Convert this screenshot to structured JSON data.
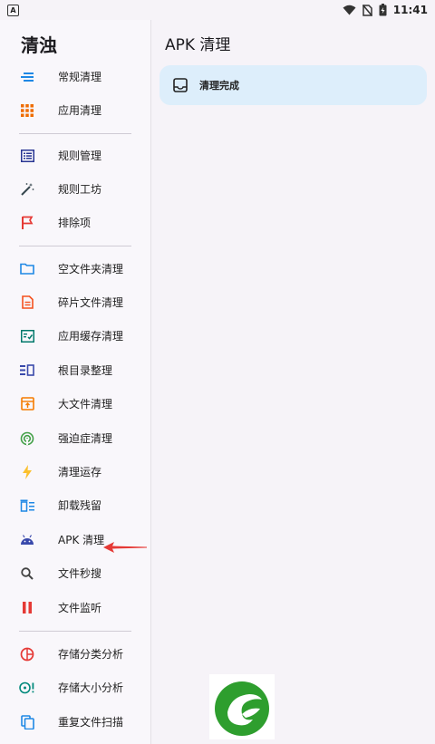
{
  "status_bar": {
    "time": "11:41",
    "notification_icon": "a-icon"
  },
  "drawer": {
    "title": "清浊",
    "groups": [
      [
        {
          "label": "常规清理",
          "icon": "lines-icon",
          "color": "#1e88e5"
        },
        {
          "label": "应用清理",
          "icon": "grid-icon",
          "color": "#ef6c00"
        }
      ],
      [
        {
          "label": "规则管理",
          "icon": "list-icon",
          "color": "#283593"
        },
        {
          "label": "规则工坊",
          "icon": "magic-wand-icon",
          "color": "#37474f"
        },
        {
          "label": "排除项",
          "icon": "flag-icon",
          "color": "#e53935"
        }
      ],
      [
        {
          "label": "空文件夹清理",
          "icon": "folder-icon",
          "color": "#1e88e5"
        },
        {
          "label": "碎片文件清理",
          "icon": "document-icon",
          "color": "#f4511e"
        },
        {
          "label": "应用缓存清理",
          "icon": "checklist-icon",
          "color": "#00796b"
        },
        {
          "label": "根目录整理",
          "icon": "root-icon",
          "color": "#3949ab"
        },
        {
          "label": "大文件清理",
          "icon": "archive-icon",
          "color": "#f57c00"
        },
        {
          "label": "强迫症清理",
          "icon": "radar-icon",
          "color": "#43a047"
        },
        {
          "label": "清理运存",
          "icon": "lightning-icon",
          "color": "#fdd835"
        },
        {
          "label": "卸载残留",
          "icon": "trash-list-icon",
          "color": "#1e88e5"
        },
        {
          "label": "APK 清理",
          "icon": "android-icon",
          "color": "#3949ab"
        },
        {
          "label": "文件秒搜",
          "icon": "search-icon",
          "color": "#424242"
        },
        {
          "label": "文件监听",
          "icon": "pause-icon",
          "color": "#e53935"
        }
      ],
      [
        {
          "label": "存储分类分析",
          "icon": "pie-icon",
          "color": "#e53935"
        },
        {
          "label": "存储大小分析",
          "icon": "storage-size-icon",
          "color": "#00897b"
        },
        {
          "label": "重复文件扫描",
          "icon": "copy-icon",
          "color": "#1e88e5"
        }
      ]
    ]
  },
  "main": {
    "title": "APK 清理",
    "card": {
      "label": "清理完成",
      "icon": "inbox-icon"
    }
  }
}
